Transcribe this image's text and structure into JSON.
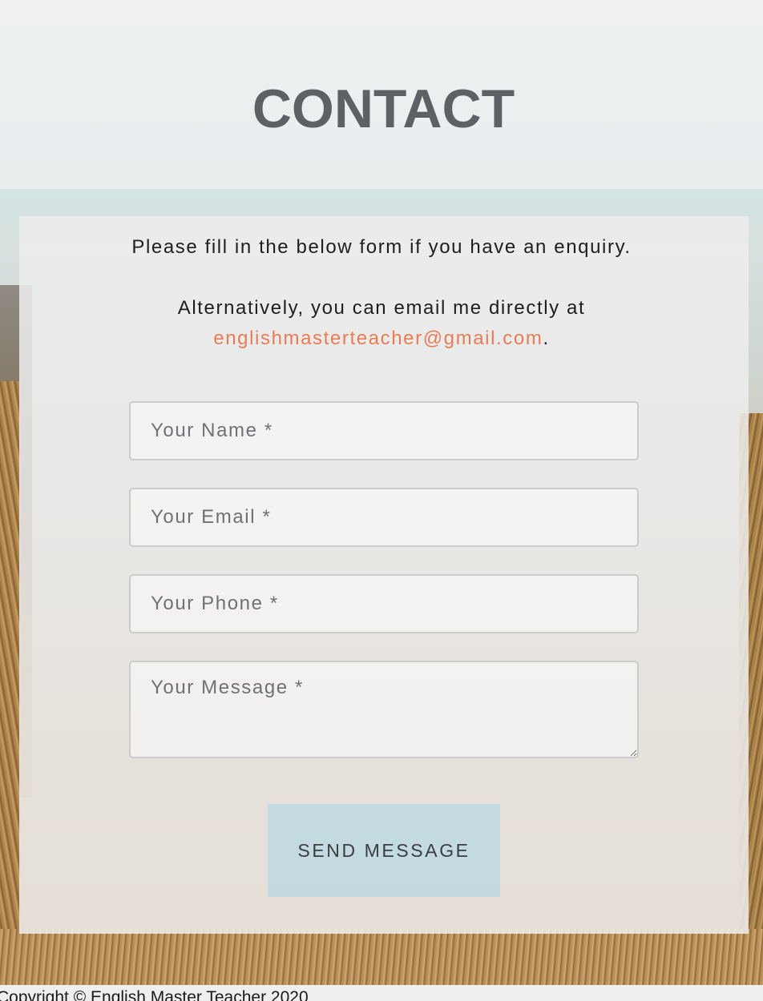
{
  "header": {
    "title": "CONTACT"
  },
  "intro": {
    "line1": "Please fill in the below form if you have an enquiry.",
    "line2": "Alternatively, you can email me directly at",
    "email": "englishmasterteacher@gmail.com",
    "trailing": "."
  },
  "form": {
    "name_placeholder": "Your Name *",
    "email_placeholder": "Your Email *",
    "phone_placeholder": "Your Phone *",
    "message_placeholder": "Your Message *",
    "name_value": "",
    "email_value": "",
    "phone_value": "",
    "message_value": "",
    "submit_label": "SEND MESSAGE"
  },
  "footer": {
    "copyright": "Copyright © English Master Teacher 2020"
  },
  "colors": {
    "link": "#ea7c55",
    "title": "#5d6064",
    "button_bg": "#bed8e0"
  }
}
